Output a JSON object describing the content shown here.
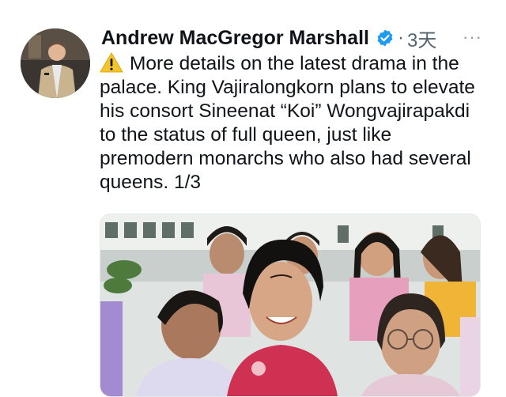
{
  "tweet": {
    "author_name": "Andrew MacGregor Marshall",
    "separator": "·",
    "time": "3天",
    "more_label": "···",
    "body": "More details on the latest drama in the palace. King Vajiralongkorn plans to elevate his consort Sineenat “Koi” Wongvajirapakdi to the status of full queen, just like premodern monarchs who also had several queens. 1/3"
  },
  "icons": {
    "verified": "verified-badge-icon",
    "warning": "warning-emoji-icon"
  },
  "colors": {
    "verified": "#1d9bf0",
    "meta_text": "#536471",
    "warning": "#f4c430"
  }
}
